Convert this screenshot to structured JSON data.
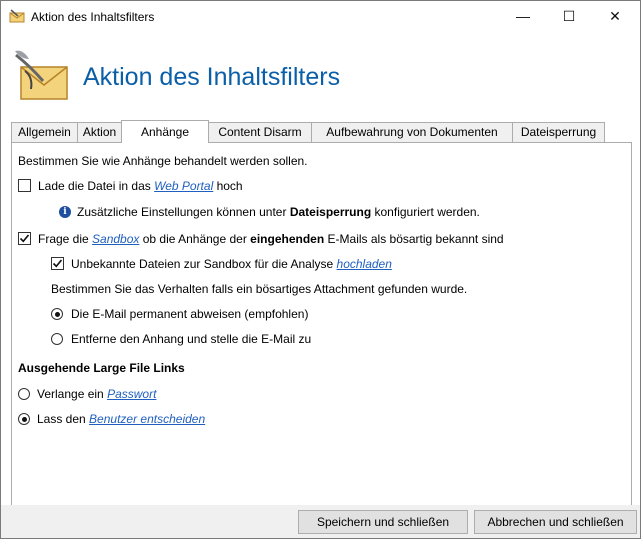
{
  "window": {
    "title": "Aktion des Inhaltsfilters",
    "min_glyph": "—",
    "max_glyph": "☐",
    "close_glyph": "✕"
  },
  "header": {
    "title": "Aktion des Inhaltsfilters"
  },
  "tabs": [
    {
      "label": "Allgemein",
      "active": false
    },
    {
      "label": "Aktion",
      "active": false
    },
    {
      "label": "Anhänge",
      "active": true
    },
    {
      "label": "Content Disarm",
      "active": false
    },
    {
      "label": "Aufbewahrung von Dokumenten",
      "active": false
    },
    {
      "label": "Dateisperrung",
      "active": false
    }
  ],
  "content": {
    "intro": "Bestimmen Sie wie Anhänge behandelt werden sollen.",
    "webportal": {
      "checked": false,
      "pre": "Lade die Datei in das ",
      "link": "Web Portal",
      "post": " hoch"
    },
    "info": {
      "pre": "Zusätzliche Einstellungen können unter ",
      "bold": "Dateisperrung",
      "post": " konfiguriert werden."
    },
    "sandbox": {
      "checked": true,
      "pre": "Frage die ",
      "link": "Sandbox",
      "mid": " ob die Anhänge der ",
      "bold": "eingehenden",
      "post": " E-Mails als bösartig bekannt sind"
    },
    "upload": {
      "checked": true,
      "pre": "Unbekannte Dateien zur Sandbox für die Analyse ",
      "link": "hochladen"
    },
    "behavior_label": "Bestimmen Sie das Verhalten falls ein bösartiges Attachment gefunden wurde.",
    "reject": {
      "selected": true,
      "label": "Die E-Mail permanent abweisen (empfohlen)"
    },
    "remove": {
      "selected": false,
      "label": "Entferne den Anhang und stelle die E-Mail zu"
    },
    "outgoing_heading": "Ausgehende Large File Links",
    "password": {
      "selected": false,
      "pre": "Verlange ein ",
      "link": "Passwort"
    },
    "user_decides": {
      "selected": true,
      "pre": "Lass den ",
      "link": "Benutzer entscheiden"
    }
  },
  "footer": {
    "save_label": "Speichern und schließen",
    "cancel_label": "Abbrechen und schließen"
  },
  "colors": {
    "header_title": "#0b5fa8",
    "link": "#1f5fbf",
    "info_icon": "#1e4f9e",
    "footer_bg": "#f0f0f0"
  },
  "icons": {
    "app": "envelope-quill-icon",
    "info": "info-icon"
  }
}
